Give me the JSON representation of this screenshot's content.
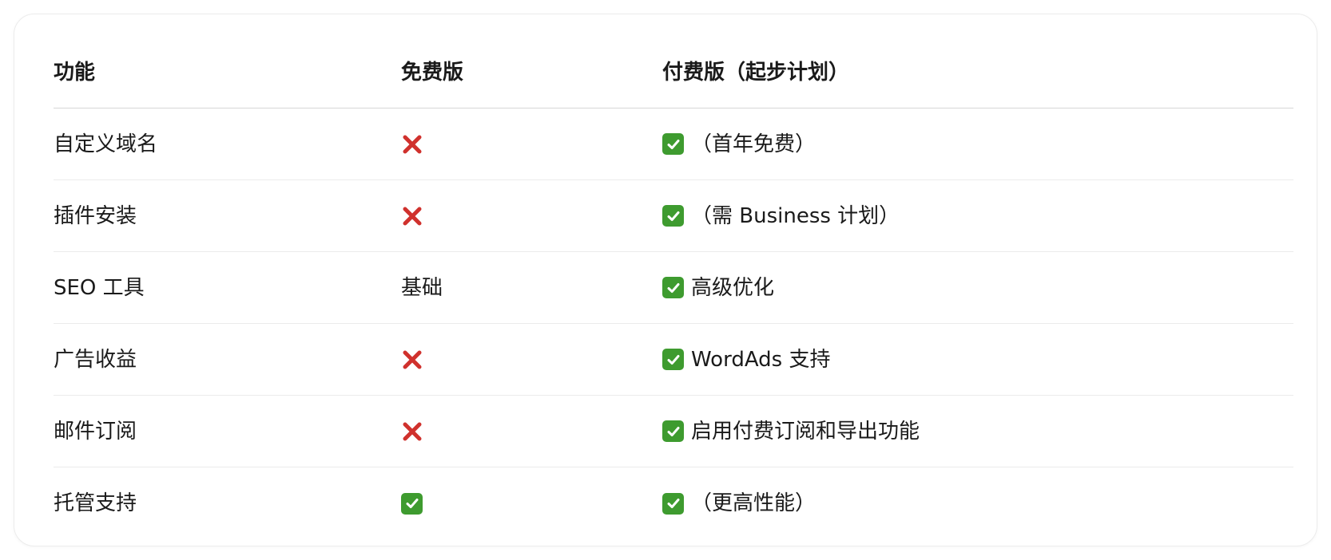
{
  "table": {
    "headers": [
      "功能",
      "免费版",
      "付费版（起步计划）"
    ],
    "rows": [
      {
        "feature": "自定义域名",
        "free": {
          "icon": "cross-icon",
          "text": ""
        },
        "paid": {
          "icon": "check-icon",
          "text": "（首年免费）"
        }
      },
      {
        "feature": "插件安装",
        "free": {
          "icon": "cross-icon",
          "text": ""
        },
        "paid": {
          "icon": "check-icon",
          "text": "（需 Business 计划）"
        }
      },
      {
        "feature": "SEO 工具",
        "free": {
          "icon": "",
          "text": "基础"
        },
        "paid": {
          "icon": "check-icon",
          "text": "高级优化"
        }
      },
      {
        "feature": "广告收益",
        "free": {
          "icon": "cross-icon",
          "text": ""
        },
        "paid": {
          "icon": "check-icon",
          "text": "WordAds 支持"
        }
      },
      {
        "feature": "邮件订阅",
        "free": {
          "icon": "cross-icon",
          "text": ""
        },
        "paid": {
          "icon": "check-icon",
          "text": "启用付费订阅和导出功能"
        }
      },
      {
        "feature": "托管支持",
        "free": {
          "icon": "check-icon",
          "text": ""
        },
        "paid": {
          "icon": "check-icon",
          "text": "（更高性能）"
        }
      }
    ]
  },
  "colors": {
    "check_bg": "#3e9b2f",
    "cross": "#d0312d",
    "border": "#ebebeb",
    "header_border": "#d6d6d6"
  }
}
